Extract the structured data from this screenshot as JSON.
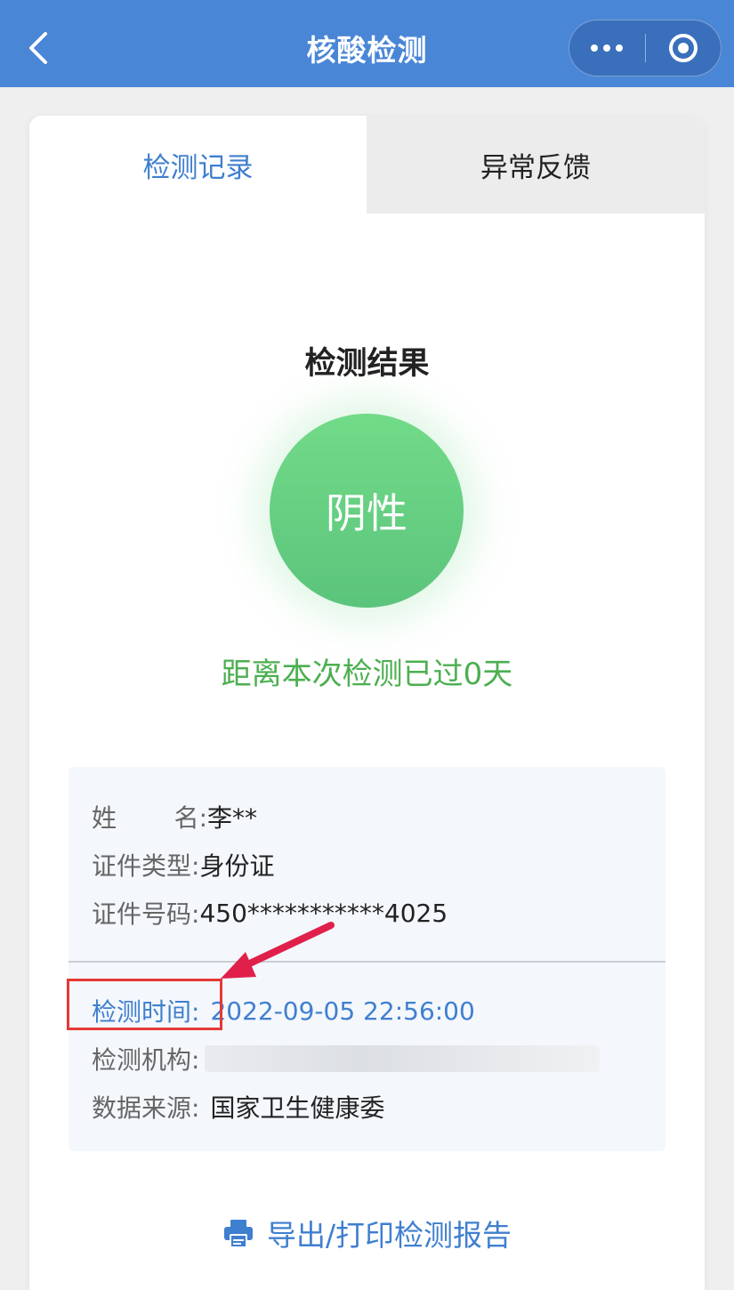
{
  "nav": {
    "title": "核酸检测",
    "back_icon": "chevron-left-icon",
    "more_icon": "more-dots-icon",
    "close_icon": "target-circle-icon"
  },
  "tabs": [
    {
      "label": "检测记录",
      "active": true
    },
    {
      "label": "异常反馈",
      "active": false
    }
  ],
  "result": {
    "title": "检测结果",
    "status": "阴性",
    "status_color": "#5bc47c",
    "days_text": "距离本次检测已过0天",
    "days_color": "#4caf50"
  },
  "info": {
    "name_label_1": "姓",
    "name_label_2": "名:",
    "name_value": "李**",
    "id_type_label": "证件类型:",
    "id_type_value": "身份证",
    "id_number_label": "证件号码:",
    "id_number_value": "450***********4025",
    "test_time_label": "检测时间:",
    "test_time_value": "2022-09-05 22:56:00",
    "institution_label": "检测机构:",
    "data_source_label": "数据来源:",
    "data_source_value": "国家卫生健康委"
  },
  "export": {
    "label": "导出/打印检测报告",
    "icon": "printer-icon"
  },
  "colors": {
    "nav_bg": "#4a86d6",
    "accent": "#3f7fcf",
    "annotation": "#e53935"
  }
}
